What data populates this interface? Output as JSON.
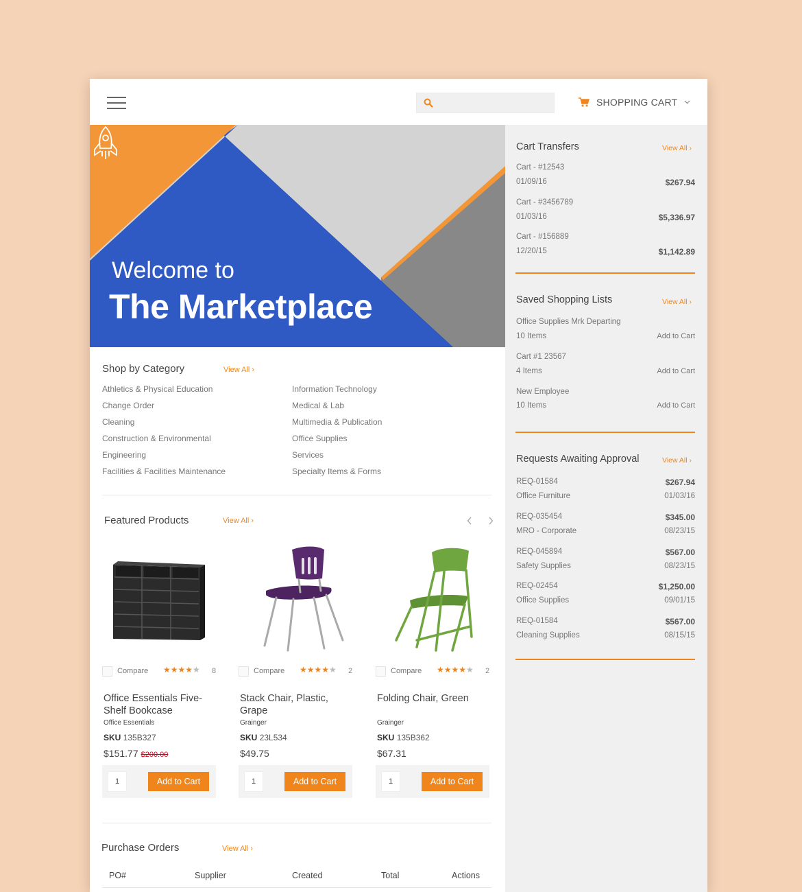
{
  "header": {
    "search_placeholder": "",
    "cart_label": "SHOPPING CART"
  },
  "hero": {
    "welcome": "Welcome to",
    "title": "The Marketplace"
  },
  "shop_by_category": {
    "title": "Shop by Category",
    "view_all": "View All ›",
    "left": [
      "Athletics & Physical Education",
      "Change Order",
      "Cleaning",
      "Construction & Environmental",
      "Engineering",
      "Facilities & Facilities Maintenance"
    ],
    "right": [
      "Information Technology",
      "Medical & Lab",
      "Multimedia & Publication",
      "Office Supplies",
      "Services",
      "Specialty Items & Forms"
    ]
  },
  "featured": {
    "title": "Featured Products",
    "view_all": "View All ›",
    "compare_label": "Compare",
    "add_label": "Add to Cart",
    "products": [
      {
        "name": "Office Essentials Five-Shelf Bookcase",
        "brand": "Office Essentials",
        "sku_label": "SKU",
        "sku": "135B327",
        "price": "$151.77",
        "old_price": "$200.00",
        "rating": 4,
        "reviews": "8",
        "qty": "1",
        "image": "bookcase"
      },
      {
        "name": "Stack Chair, Plastic, Grape",
        "brand": "Grainger",
        "sku_label": "SKU",
        "sku": "23L534",
        "price": "$49.75",
        "old_price": "",
        "rating": 4,
        "reviews": "2",
        "qty": "1",
        "image": "stack-chair"
      },
      {
        "name": "Folding Chair, Green",
        "brand": "Grainger",
        "sku_label": "SKU",
        "sku": "135B362",
        "price": "$67.31",
        "old_price": "",
        "rating": 4,
        "reviews": "2",
        "qty": "1",
        "image": "folding-chair"
      }
    ]
  },
  "purchase_orders": {
    "title": "Purchase Orders",
    "view_all": "View All ›",
    "columns": [
      "PO#",
      "Supplier",
      "Created",
      "Total",
      "Actions"
    ]
  },
  "sidebar": {
    "cart_transfers": {
      "title": "Cart Transfers",
      "view_all": "View All ›",
      "items": [
        {
          "name": "Cart - #12543",
          "date": "01/09/16",
          "amount": "$267.94"
        },
        {
          "name": "Cart - #3456789",
          "date": "01/03/16",
          "amount": "$5,336.97"
        },
        {
          "name": "Cart - #156889",
          "date": "12/20/15",
          "amount": "$1,142.89"
        }
      ]
    },
    "saved_lists": {
      "title": "Saved Shopping Lists",
      "view_all": "View All ›",
      "add_label": "Add to Cart",
      "items": [
        {
          "name": "Office Supplies Mrk Departing",
          "count": "10 Items"
        },
        {
          "name": "Cart #1 23567",
          "count": "4 Items"
        },
        {
          "name": "New Employee",
          "count": "10 Items"
        }
      ]
    },
    "requests": {
      "title": "Requests Awaiting Approval",
      "view_all": "View All ›",
      "items": [
        {
          "id": "REQ-01584",
          "category": "Office Furniture",
          "amount": "$267.94",
          "date": "01/03/16"
        },
        {
          "id": "REQ-035454",
          "category": "MRO - Corporate",
          "amount": "$345.00",
          "date": "08/23/15"
        },
        {
          "id": "REQ-045894",
          "category": "Safety Supplies",
          "amount": "$567.00",
          "date": "08/23/15"
        },
        {
          "id": "REQ-02454",
          "category": "Office Supplies",
          "amount": "$1,250.00",
          "date": "09/01/15"
        },
        {
          "id": "REQ-01584",
          "category": "Cleaning Supplies",
          "amount": "$567.00",
          "date": "08/15/15"
        }
      ]
    }
  },
  "colors": {
    "accent": "#f0861b",
    "hero_blue": "#2f5ac4",
    "hero_orange": "#f39638",
    "hero_gray": "#8a8a8a",
    "hero_light": "#d3d3d3",
    "sidebar_bg": "#f0f0f0"
  }
}
